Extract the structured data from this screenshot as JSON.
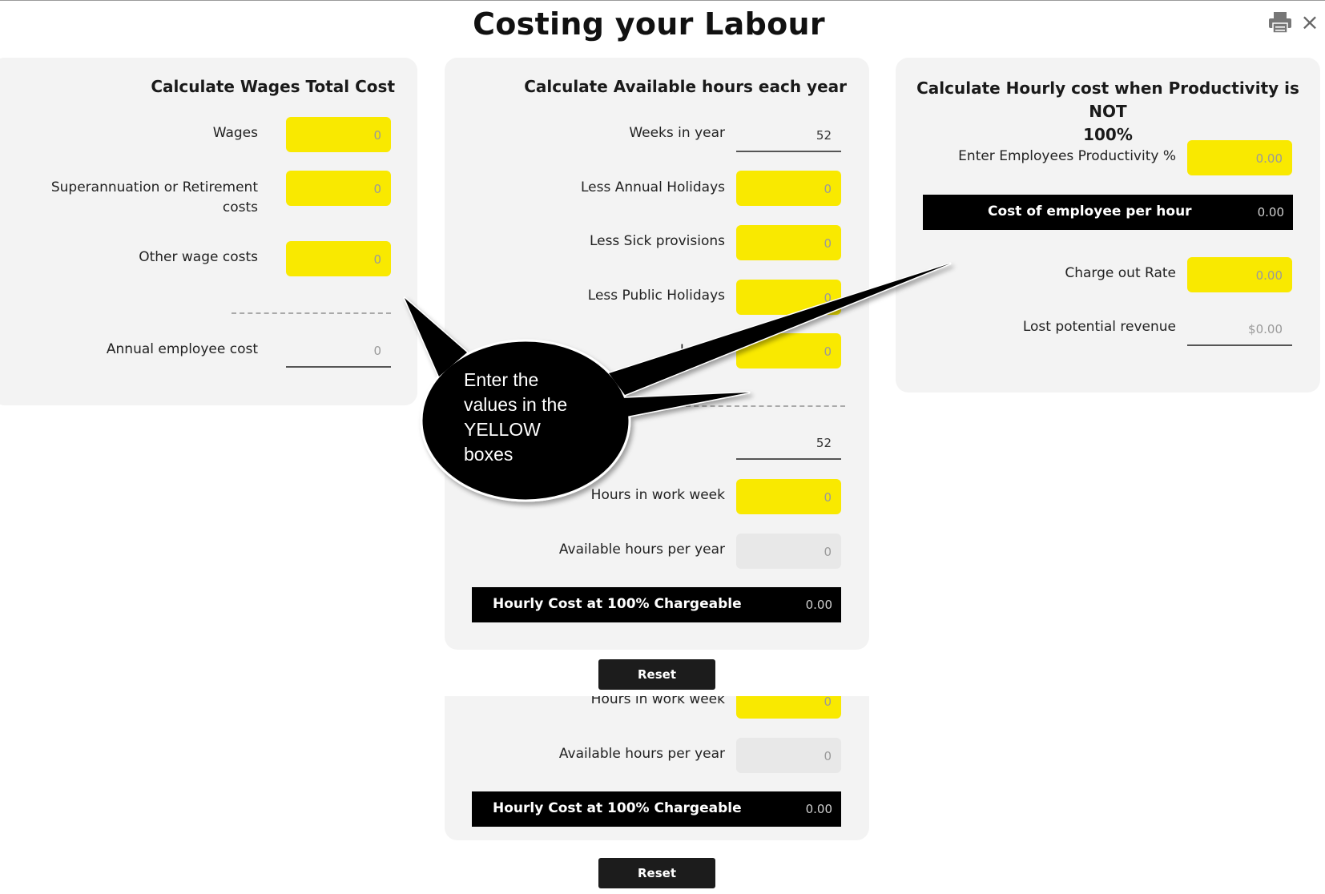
{
  "page": {
    "title": "Costing your Labour"
  },
  "wages_panel": {
    "title": "Calculate Wages Total Cost",
    "wages_label": "Wages",
    "wages_value": "0",
    "super_label_line1": "Superannuation or Retirement",
    "super_label_line2": "costs",
    "super_value": "0",
    "other_label": "Other wage costs",
    "other_value": "0",
    "annual_label": "Annual employee cost",
    "annual_value": "0"
  },
  "hours_panel": {
    "title": "Calculate Available hours each year",
    "weeks_label": "Weeks in year",
    "weeks_value": "52",
    "annual_hol_label": "Less Annual Holidays",
    "annual_hol_value": "0",
    "sick_label": "Less Sick provisions",
    "sick_value": "0",
    "public_hol_label": "Less Public Holidays",
    "public_hol_value": "0",
    "less_other_label": "Less O",
    "less_other_value": "0",
    "total_weeks_value": "52",
    "work_week_label": "Hours in work week",
    "work_week_value": "0",
    "available_label": "Available hours per year",
    "available_value": "0",
    "hourly_label": "Hourly Cost at 100% Chargeable",
    "hourly_value": "0.00",
    "reset_label": "Reset"
  },
  "productivity_panel": {
    "title_line1": "Calculate Hourly cost when Productivity is NOT",
    "title_line2": "100%",
    "productivity_label": "Enter Employees Productivity %",
    "productivity_value": "0.00",
    "cost_per_hour_label": "Cost of employee per hour",
    "cost_per_hour_value": "0.00",
    "charge_label": "Charge out Rate",
    "charge_value": "0.00",
    "lost_label": "Lost potential revenue",
    "lost_value": "$0.00"
  },
  "lower_copy": {
    "work_week_label": "Hours in work week",
    "work_week_value": "0",
    "available_label": "Available hours per year",
    "available_value": "0",
    "hourly_label": "Hourly Cost at 100% Chargeable",
    "hourly_value": "0.00",
    "reset_label": "Reset"
  },
  "callout": {
    "line1": "Enter the",
    "line2": "values in the",
    "line3": "YELLOW",
    "line4": "boxes"
  },
  "colors": {
    "yellow": "#f9e900",
    "panel_bg": "#f3f3f3",
    "bar_black": "#000000"
  },
  "icons": [
    "printer-icon",
    "close-icon"
  ]
}
